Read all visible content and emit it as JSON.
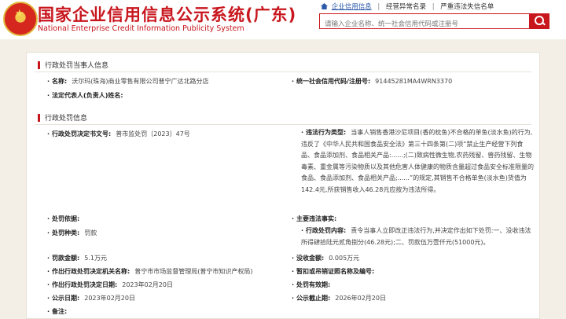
{
  "header": {
    "title": "国家企业信用信息公示系统(广东)",
    "subtitle": "National Enterprise Credit Information Publicity System",
    "links": [
      "企业信用信息",
      "经营异常名录",
      "严重违法失信名单"
    ],
    "home_icon": "home-icon",
    "search_placeholder": "请输入企业名称、统一社会信用代码或注册号",
    "search_icon": "search-icon"
  },
  "party": {
    "section_title": "行政处罚当事人信息",
    "name_label": "名称:",
    "name_value": "沃尔玛(珠海)商业零售有限公司普宁广达北路分店",
    "credit_code_label": "统一社会信用代码/注册号:",
    "credit_code_value": "91445281MA4WRN3370",
    "legal_rep_label": "法定代表人(负责人)姓名:",
    "legal_rep_value": ""
  },
  "penalty": {
    "section_title": "行政处罚信息",
    "decision_no_label": "行政处罚决定书文号:",
    "decision_no_value": "普市监处罚〔2023〕47号",
    "violation_label": "违法行为类型:",
    "violation_value": "当事人销售香港沙尼项目(香的枕鱼)不合格的单鱼(淡水鱼)的行为,违反了《中华人民共和国食品安全法》第三十四条第(二)项“禁止生产经营下列食品、食品添加剂、食品相关产品:......;(二)致病性微生物,农药残留、兽药残留、生物毒素、重金属等污染物质以及其他危害人体健康的物质含量超过食品安全标准限量的食品、食品添加剂、食品相关产品;......”的规定,其销售不合格单鱼(淡水鱼)货值为142.4元,所获销售收入46.28元应按为违法所得。",
    "basis_label": "处罚依据:",
    "basis_value": "",
    "main_facts_label": "主要违法事实:",
    "main_facts_value": "",
    "type_label": "处罚种类:",
    "type_value": "罚款",
    "content_label": "行政处罚内容:",
    "content_value": "责令当事人立即改正违法行为,并决定作出如下处罚:一、没收违法所得肆拾陆元贰角捌分(46.28元);二、罚款伍万壹仟元(51000元)。",
    "fine_label": "罚款金额:",
    "fine_value": "5.1万元",
    "confiscation_label": "没收金额:",
    "confiscation_value": "0.005万元",
    "authority_label": "作出行政处罚决定机关名称:",
    "authority_value": "普宁市市场监督管理局(普宁市知识产权局)",
    "suspension_label": "暂扣或吊销证照名称及编号:",
    "suspension_value": "",
    "decision_date_label": "作出行政处罚决定日期:",
    "decision_date_value": "2023年02月20日",
    "deadline_label": "处罚有效期:",
    "deadline_value": "",
    "publish_date_label": "公示日期:",
    "publish_date_value": "2023年02月20日",
    "publish_end_label": "公示截止期:",
    "publish_end_value": "2026年02月20日",
    "remarks_label": "备注:",
    "remarks_value": ""
  }
}
